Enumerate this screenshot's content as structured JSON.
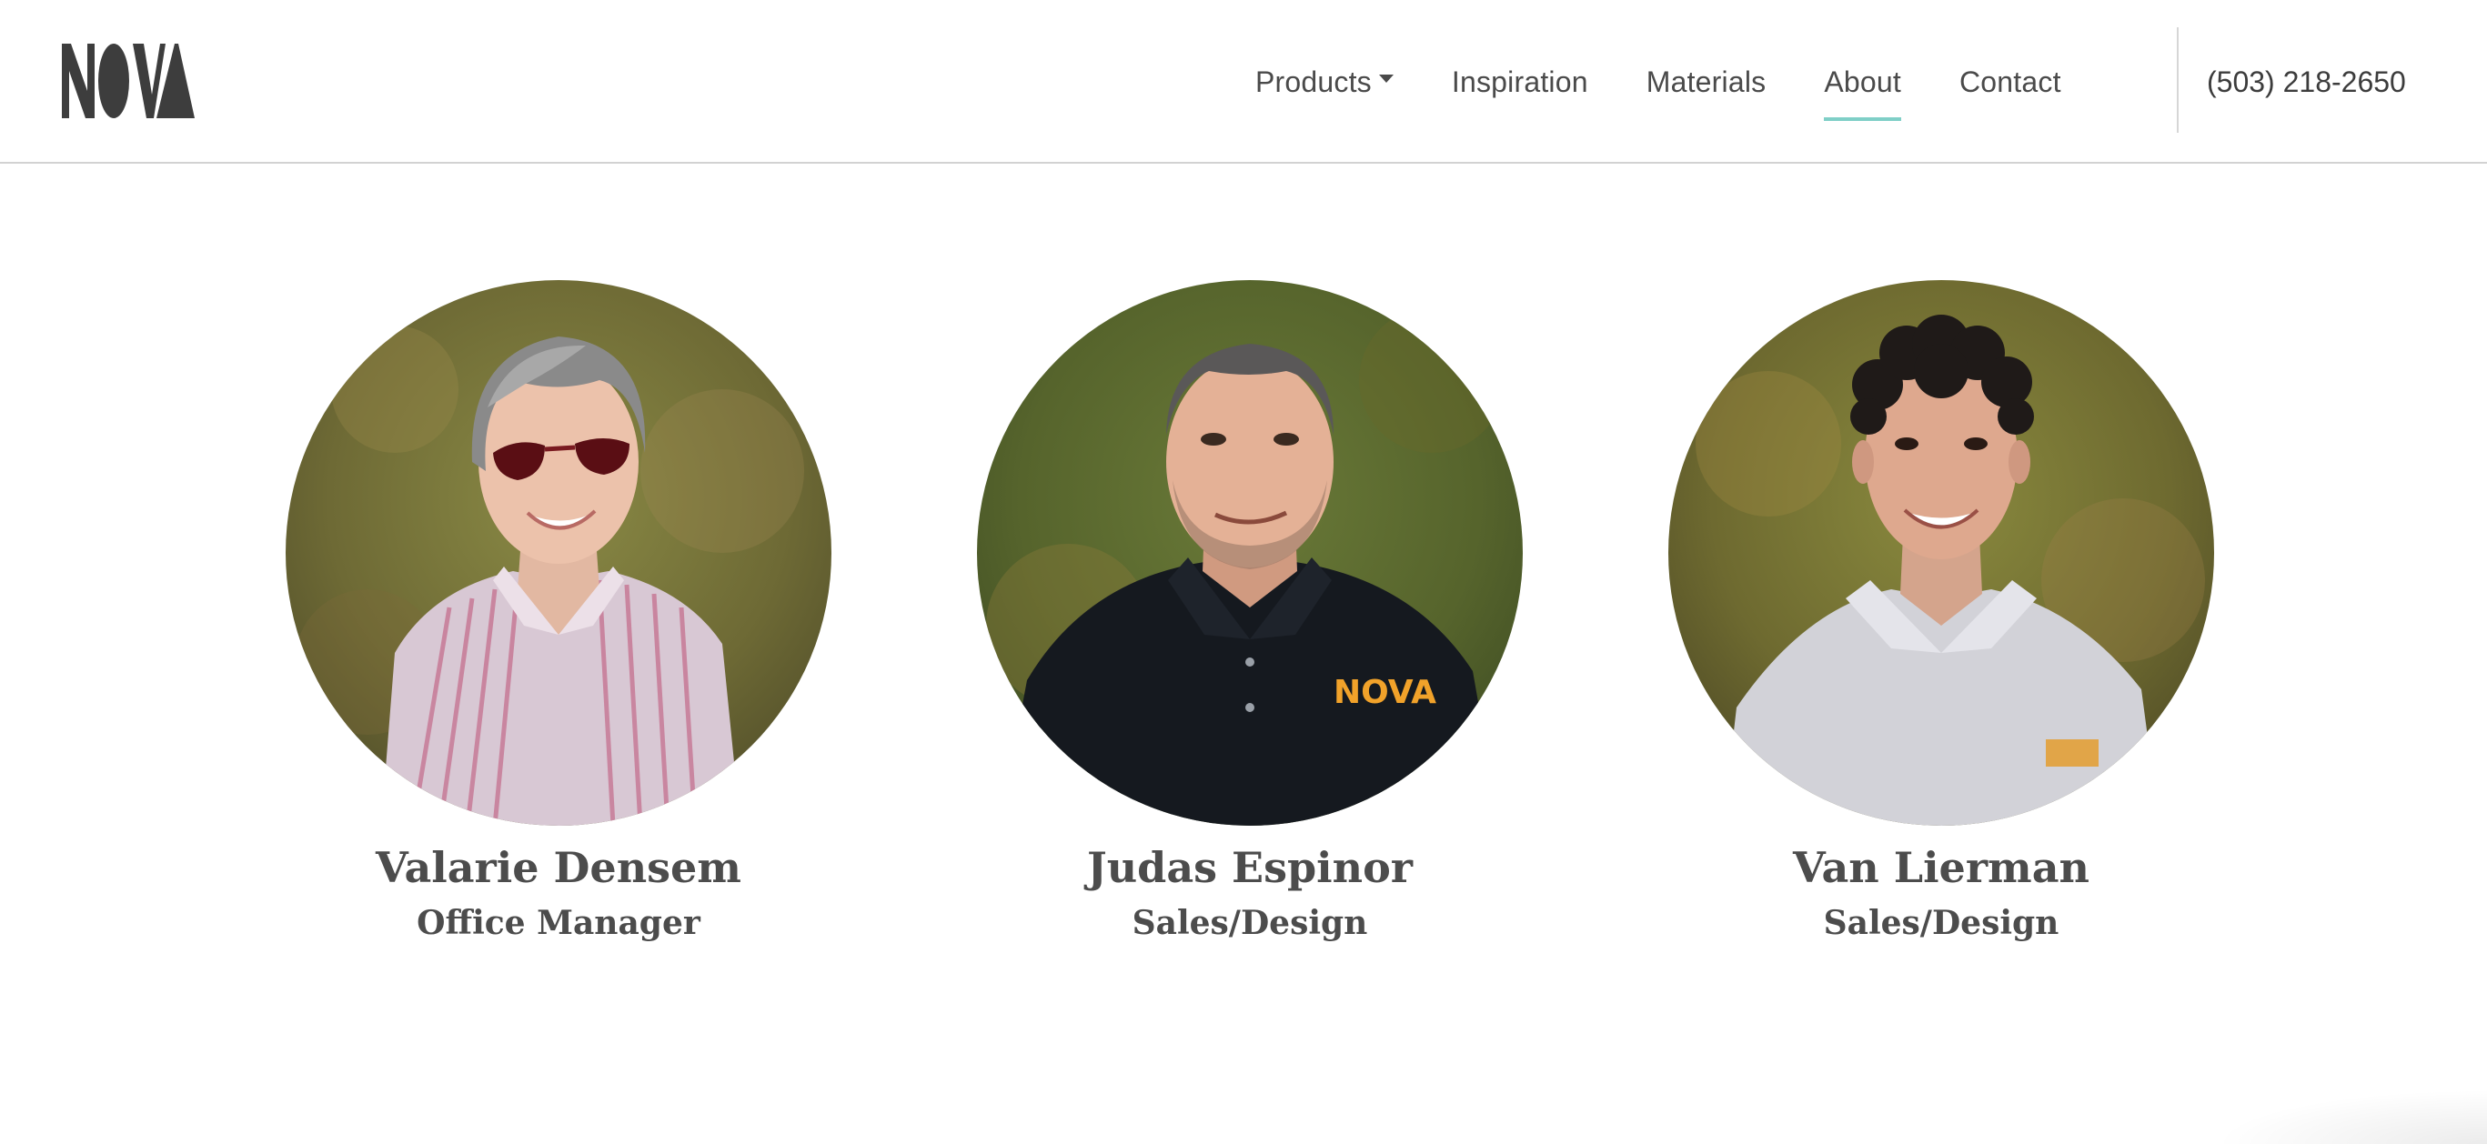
{
  "brand": {
    "logo_text": "NOVA",
    "logo_color": "#3d3d3d"
  },
  "nav": {
    "items": [
      {
        "label": "Products",
        "has_dropdown": true,
        "active": false
      },
      {
        "label": "Inspiration",
        "active": false
      },
      {
        "label": "Materials",
        "active": false
      },
      {
        "label": "About",
        "active": true
      },
      {
        "label": "Contact",
        "active": false
      }
    ],
    "phone": "(503) 218-2650",
    "active_underline_color": "#7fcfc7"
  },
  "team": [
    {
      "name": "Valarie Densem",
      "role": "Office Manager"
    },
    {
      "name": "Judas Espinor",
      "role": "Sales/Design"
    },
    {
      "name": "Van Lierman",
      "role": "Sales/Design"
    }
  ],
  "shirt_logo_text": "NOVA",
  "colors": {
    "text": "#4a4a4a",
    "divider": "#d2d2d2",
    "background": "#ffffff"
  }
}
